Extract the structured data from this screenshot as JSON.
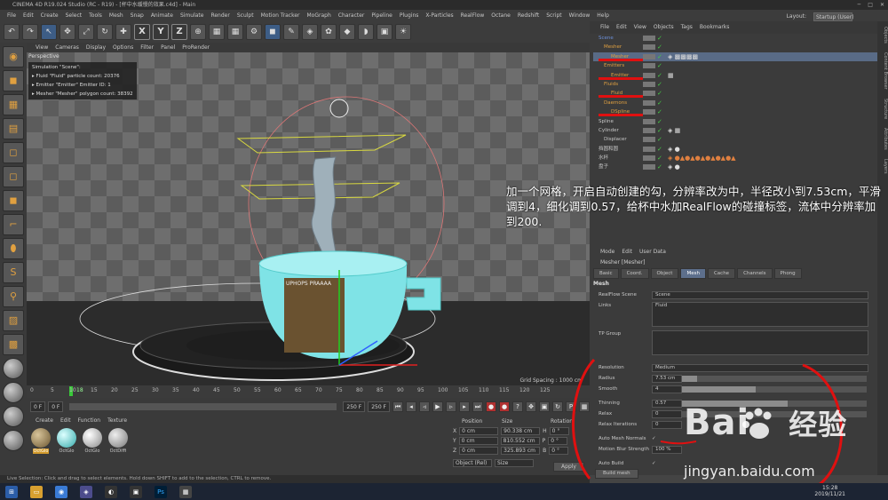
{
  "window": {
    "title": "CINEMA 4D R19.024 Studio (RC - R19) - [杯中水缓慢的效果.c4d] - Main"
  },
  "menu": [
    "File",
    "Edit",
    "Create",
    "Select",
    "Tools",
    "Mesh",
    "Snap",
    "Animate",
    "Simulate",
    "Render",
    "Sculpt",
    "Motion Tracker",
    "MoGraph",
    "Character",
    "Pipeline",
    "Plugins",
    "X-Particles",
    "RealFlow",
    "Octane",
    "Redshift",
    "Script",
    "Window",
    "Help"
  ],
  "layout": {
    "label": "Layout:",
    "value": "Startup (User)"
  },
  "toolbar": {
    "x": "X",
    "y": "Y",
    "z": "Z"
  },
  "viewport": {
    "menu": [
      "View",
      "Cameras",
      "Display",
      "Options",
      "Filter",
      "Panel",
      "ProRender"
    ],
    "name": "Perspective",
    "sim_title": "Simulation \"Scene\":",
    "sim_lines": [
      "Fluid \"Fluid\" particle count: 20376",
      "Emitter \"Emitter\" Emitter ID: 1",
      "Mesher \"Mesher\" polygon count: 38392"
    ],
    "grid_spacing": "Grid Spacing : 1000 cm",
    "poster_text": "UPHOPS PRAAAA"
  },
  "timeline": {
    "ticks": [
      "0",
      "5",
      "10",
      "15",
      "20",
      "25",
      "30",
      "35",
      "40",
      "45",
      "50",
      "55",
      "60",
      "65",
      "70",
      "75",
      "80",
      "85",
      "90",
      "95",
      "100",
      "105",
      "110",
      "115",
      "120",
      "125"
    ],
    "current": "18"
  },
  "frames": {
    "start": "0 F",
    "current": "0 F",
    "end": "250 F",
    "end2": "250 F"
  },
  "materials": {
    "menu": [
      "Create",
      "Edit",
      "Function",
      "Texture"
    ],
    "items": [
      "OctGlo",
      "OctGlo",
      "OctGlo",
      "OctDiffi"
    ]
  },
  "coords": {
    "headers": [
      "Position",
      "Size",
      "Rotation"
    ],
    "rows": [
      [
        "X",
        "0 cm",
        "90.338 cm",
        "H",
        "0 °"
      ],
      [
        "Y",
        "0 cm",
        "810.552 cm",
        "P",
        "0 °"
      ],
      [
        "Z",
        "0 cm",
        "325.893 cm",
        "B",
        "0 °"
      ]
    ],
    "mode": "Object (Rel)",
    "size_mode": "Size",
    "apply": "Apply"
  },
  "status": "Live Selection: Click and drag to select elements. Hold down SHIFT to add to the selection, CTRL to remove.",
  "objects": {
    "menu": [
      "File",
      "Edit",
      "View",
      "Objects",
      "Tags",
      "Bookmarks"
    ],
    "items": [
      {
        "name": "Scene",
        "indent": 0,
        "color": "#6b8fd8"
      },
      {
        "name": "Mesher",
        "indent": 1,
        "color": "#e0a040"
      },
      {
        "name": "Mesher",
        "indent": 2,
        "color": "#e0a040",
        "selected": true
      },
      {
        "name": "Emitters",
        "indent": 1,
        "color": "#e0a040"
      },
      {
        "name": "Emitter",
        "indent": 2,
        "color": "#e0a040"
      },
      {
        "name": "Fluids",
        "indent": 1,
        "color": "#e0a040"
      },
      {
        "name": "Fluid",
        "indent": 2,
        "color": "#e0a040"
      },
      {
        "name": "Daemons",
        "indent": 1,
        "color": "#e0a040"
      },
      {
        "name": "DSpline",
        "indent": 2,
        "color": "#e0a040"
      },
      {
        "name": "Spline",
        "indent": 0,
        "color": "#ccc"
      },
      {
        "name": "Cylinder",
        "indent": 0,
        "color": "#ccc"
      },
      {
        "name": "Displacer",
        "indent": 1,
        "color": "#ccc"
      },
      {
        "name": "挡圆和圆",
        "indent": 0,
        "color": "#ccc"
      },
      {
        "name": "水杯",
        "indent": 0,
        "color": "#ccc"
      },
      {
        "name": "盘子",
        "indent": 0,
        "color": "#ccc"
      }
    ]
  },
  "attributes": {
    "menu": [
      "Mode",
      "Edit",
      "User Data"
    ],
    "title": "Mesher [Mesher]",
    "tabs": [
      "Basic",
      "Coord.",
      "Object",
      "Mesh",
      "Cache",
      "Channels",
      "Phong"
    ],
    "active_tab": "Mesh",
    "section": "Mesh",
    "realflow_scene_label": "RealFlow Scene",
    "realflow_scene_value": "Scene",
    "links_label": "Links",
    "links_value": "Fluid",
    "tp_group_label": "TP Group",
    "params": [
      {
        "label": "Resolution",
        "value": "Medium",
        "fill": 0
      },
      {
        "label": "Radius",
        "value": "7.53 cm",
        "fill": 0.08
      },
      {
        "label": "Smooth",
        "value": "4",
        "fill": 0.4
      },
      {
        "label": "Thinning",
        "value": "0.57",
        "fill": 0.57
      },
      {
        "label": "Relax",
        "value": "0",
        "fill": 0
      },
      {
        "label": "Relax Iterations",
        "value": "0",
        "fill": 0
      },
      {
        "label": "Auto Mesh Normals",
        "value": "✓",
        "fill": 0
      },
      {
        "label": "Motion Blur Strength",
        "value": "100 %",
        "fill": 0
      },
      {
        "label": "Auto Build",
        "value": "✓",
        "fill": 0
      }
    ],
    "build_button": "Build mesh"
  },
  "right_tabs": [
    "Objects",
    "Content Browser",
    "Structure",
    "Attributes",
    "Layers"
  ],
  "annotation": "加一个网格，开启自动创建的勾，分辨率改为中，半径改小到7.53cm，平滑调到4，细化调到0.57，给杯中水加RealFlow的碰撞标签，流体中分辨率加到200.",
  "watermark": {
    "brand": "Bai",
    "brand2": "经验",
    "url": "jingyan.baidu.com"
  },
  "clock": {
    "time": "15:28",
    "date": "2019/11/21"
  },
  "colors": {
    "selected_row": "#596b86",
    "annotation_red": "#e01010",
    "cup": "#7fe3e6"
  }
}
